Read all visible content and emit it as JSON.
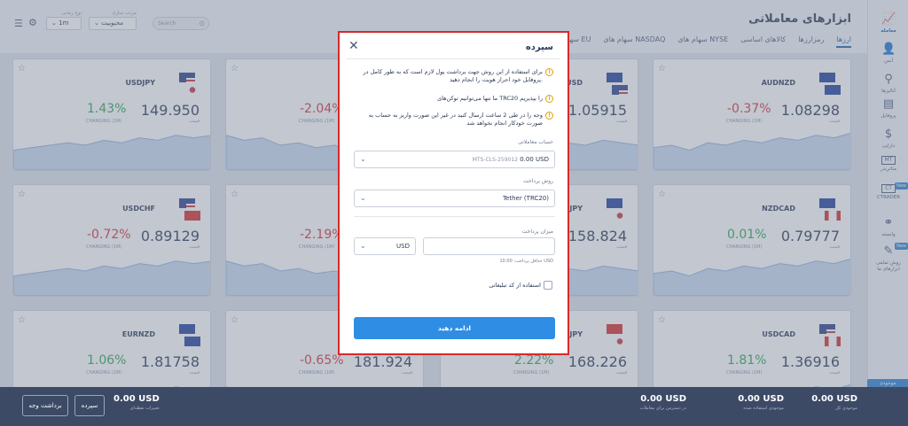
{
  "header": {
    "title": "ابزارهای معاملاتی",
    "tabs": [
      "ارزها",
      "رمزارزها",
      "کالاهای اساسی",
      "سهام های NYSE",
      "سهام های NASDAQ",
      "سهام های EU"
    ],
    "search_placeholder": "Search",
    "sort_label": "مرتب سازی",
    "sort_value": "محبوبیت",
    "timeframe_label": "نوع زمانی",
    "timeframe_value": "1m"
  },
  "sidebar": {
    "items": [
      {
        "label": "معامله",
        "icon": "chart-trade-icon"
      },
      {
        "label": "آنس",
        "icon": "user-icon"
      },
      {
        "label": "آنالیزها",
        "icon": "analysis-icon"
      },
      {
        "label": "پروفایل",
        "icon": "profile-card-icon"
      },
      {
        "label": "دارایی",
        "icon": "dollar-coin-icon"
      },
      {
        "label": "متاتریدر",
        "icon": "mt-icon"
      },
      {
        "label": "CTRADER",
        "icon": "ct-icon",
        "badge": "New"
      },
      {
        "label": "وابسته",
        "icon": "handshake-icon"
      },
      {
        "label": "روش تمامی ابزارهای ما",
        "icon": "tools-icon",
        "badge": "New"
      }
    ],
    "help_label": "موجودی"
  },
  "cards": [
    {
      "symbol": "AUDNZD",
      "price": "1.08298",
      "change": "-0.37%",
      "dir": "down",
      "flags": [
        "au",
        "nz"
      ]
    },
    {
      "symbol": "EURUSD",
      "price": "1.05915",
      "change": "",
      "dir": "up",
      "flags": [
        "eu",
        "us"
      ]
    },
    {
      "symbol": "",
      "price": "",
      "change": "-2.04%",
      "dir": "down",
      "flags": []
    },
    {
      "symbol": "USDJPY",
      "price": "149.950",
      "change": "1.43%",
      "dir": "up",
      "flags": [
        "us",
        "jp"
      ]
    },
    {
      "symbol": "NZDCAD",
      "price": "0.79777",
      "change": "0.01%",
      "dir": "up",
      "flags": [
        "nz",
        "ca"
      ]
    },
    {
      "symbol": "EURJPY",
      "price": "158.824",
      "change": "",
      "dir": "up",
      "flags": [
        "eu",
        "jp"
      ]
    },
    {
      "symbol": "",
      "price": "",
      "change": "-2.19%",
      "dir": "down",
      "flags": []
    },
    {
      "symbol": "USDCHF",
      "price": "0.89129",
      "change": "-0.72%",
      "dir": "down",
      "flags": [
        "us",
        "ch"
      ]
    },
    {
      "symbol": "USDCAD",
      "price": "1.36916",
      "change": "1.81%",
      "dir": "up",
      "flags": [
        "us",
        "ca"
      ]
    },
    {
      "symbol": "CHFJPY",
      "price": "168.226",
      "change": "2.22%",
      "dir": "up",
      "flags": [
        "ch",
        "jp"
      ]
    },
    {
      "symbol": "",
      "price": "181.924",
      "change": "-0.65%",
      "dir": "down",
      "flags": []
    },
    {
      "symbol": "EURNZD",
      "price": "1.81758",
      "change": "1.06%",
      "dir": "up",
      "flags": [
        "eu",
        "nz"
      ]
    }
  ],
  "card_labels": {
    "price": "قیمت",
    "change": "CHANGING (1M)"
  },
  "bottom": {
    "balance_value": "0.00 USD",
    "balance_label": "موجودی کل",
    "margin_value": "0.00 USD",
    "margin_label": "موجودی استفاده شده",
    "free_value": "0.00 USD",
    "free_label": "در دسترس برای معاملات",
    "pnl_value": "0.00 USD",
    "pnl_label": "تغییرات نقطه‌ای",
    "deposit_btn": "سپرده",
    "withdraw_btn": "برداشت وجه"
  },
  "modal": {
    "title": "سپرده",
    "notices": [
      "برای استفاده از این روش جهت برداشت پول لازم است که به طور کامل در پروفایل خود احراز هویت را انجام دهید.",
      "ما تنها می‌توانیم توکن‌های TRC20 را بپذیریم",
      "وجه را در طی 2 ساعت ارسال کنید در غیر این صورت واریز به حساب به صورت خودکار انجام نخواهد شد"
    ],
    "account_label": "حساب معاملاتی",
    "account_value": "0.00 USD",
    "account_id": "MTS-CLS-259012",
    "method_label": "روش پرداخت",
    "method_value": "Tether (TRC20)",
    "amount_label": "میزان پرداخت",
    "amount_value": "",
    "currency_value": "USD",
    "min_hint": "حداقل پرداخت: 10.00 USD",
    "promo_label": "استفاده از کد تبلیغاتی",
    "submit_label": "ادامه دهید"
  },
  "colors": {
    "up": "#2ea44f",
    "down": "#d9303b",
    "accent": "#2f8de4",
    "highlight": "#d62a2a"
  }
}
